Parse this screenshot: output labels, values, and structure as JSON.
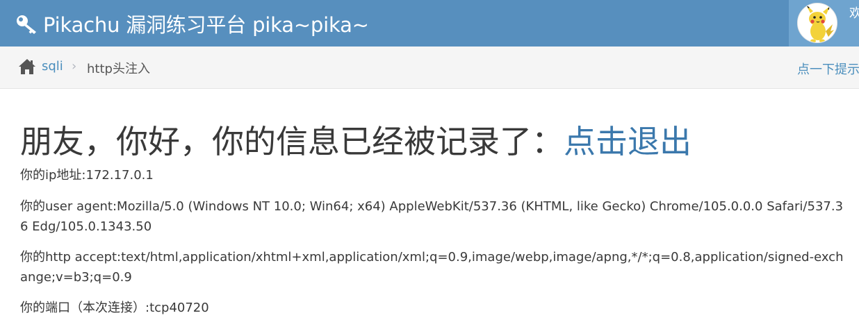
{
  "navbar": {
    "title": "Pikachu 漏洞练习平台 pika~pika~",
    "welcome": "欢迎"
  },
  "breadcrumb": {
    "parent": "sqli",
    "current": "http头注入",
    "hint": "点一下提示"
  },
  "main": {
    "heading_text": "朋友，你好，你的信息已经被记录了：",
    "logout_link": "点击退出",
    "ip": "你的ip地址:172.17.0.1",
    "user_agent": "你的user agent:Mozilla/5.0 (Windows NT 10.0; Win64; x64) AppleWebKit/537.36 (KHTML, like Gecko) Chrome/105.0.0.0 Safari/537.36 Edg/105.0.1343.50",
    "accept": "你的http accept:text/html,application/xhtml+xml,application/xml;q=0.9,image/webp,image/apng,*/*;q=0.8,application/signed-exchange;v=b3;q=0.9",
    "port": "你的端口（本次连接）:tcp40720"
  },
  "colors": {
    "navbar_bg": "#578fbe",
    "link": "#3b78ac"
  },
  "icons": {
    "brand": "key-icon",
    "home": "home-icon",
    "separator": "chevron-right-icon",
    "avatar": "pikachu-avatar"
  }
}
